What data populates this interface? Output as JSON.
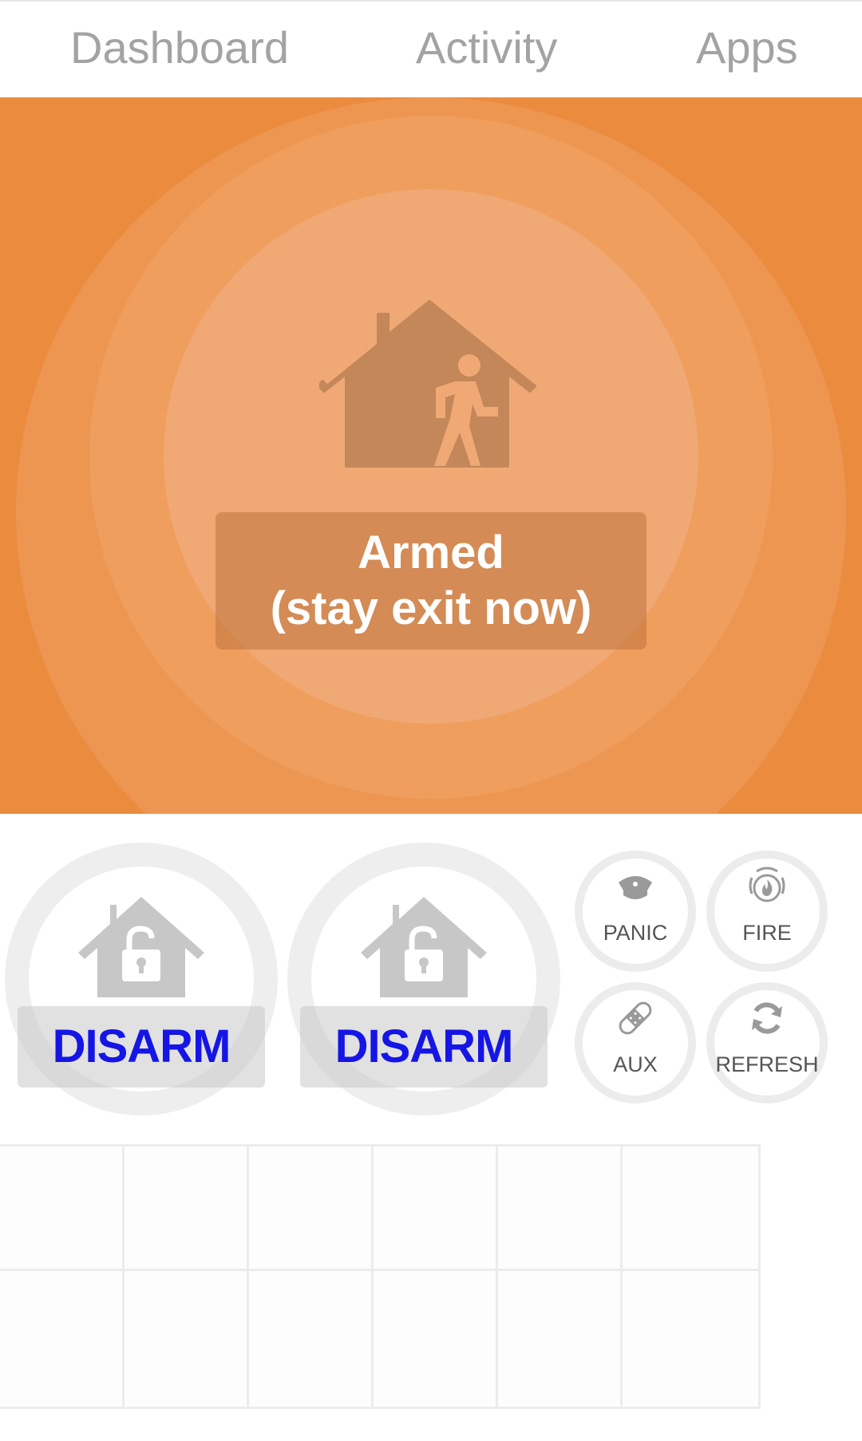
{
  "topnav": {
    "tabs": [
      {
        "label": "Dashboard"
      },
      {
        "label": "Activity"
      },
      {
        "label": "Apps"
      }
    ]
  },
  "hero": {
    "status_title": "Armed",
    "status_subtitle": "(stay exit now)",
    "icon": "house-person-exit-icon",
    "colors": {
      "background": "#EB8B3E",
      "ring_outer": "#ED9651",
      "ring_middle": "#EF9E5E",
      "ring_inner": "#F0A974",
      "icon": "#C38759",
      "figure": "#F0A974"
    }
  },
  "controls": {
    "arm_buttons": [
      {
        "label": "DISARM",
        "icon": "house-unlocked-icon"
      },
      {
        "label": "DISARM",
        "icon": "house-unlocked-icon"
      }
    ],
    "emergency_buttons": [
      {
        "label": "PANIC",
        "icon": "police-cap-icon"
      },
      {
        "label": "FIRE",
        "icon": "fire-icon"
      },
      {
        "label": "AUX",
        "icon": "bandage-icon"
      },
      {
        "label": "REFRESH",
        "icon": "refresh-icon"
      }
    ],
    "colors": {
      "disarm_text": "#1515E6",
      "icon_gray": "#C7C7C7",
      "ring_gray": "#EEEEEE"
    }
  },
  "tiles": {
    "rows": 2,
    "columns": 6
  }
}
